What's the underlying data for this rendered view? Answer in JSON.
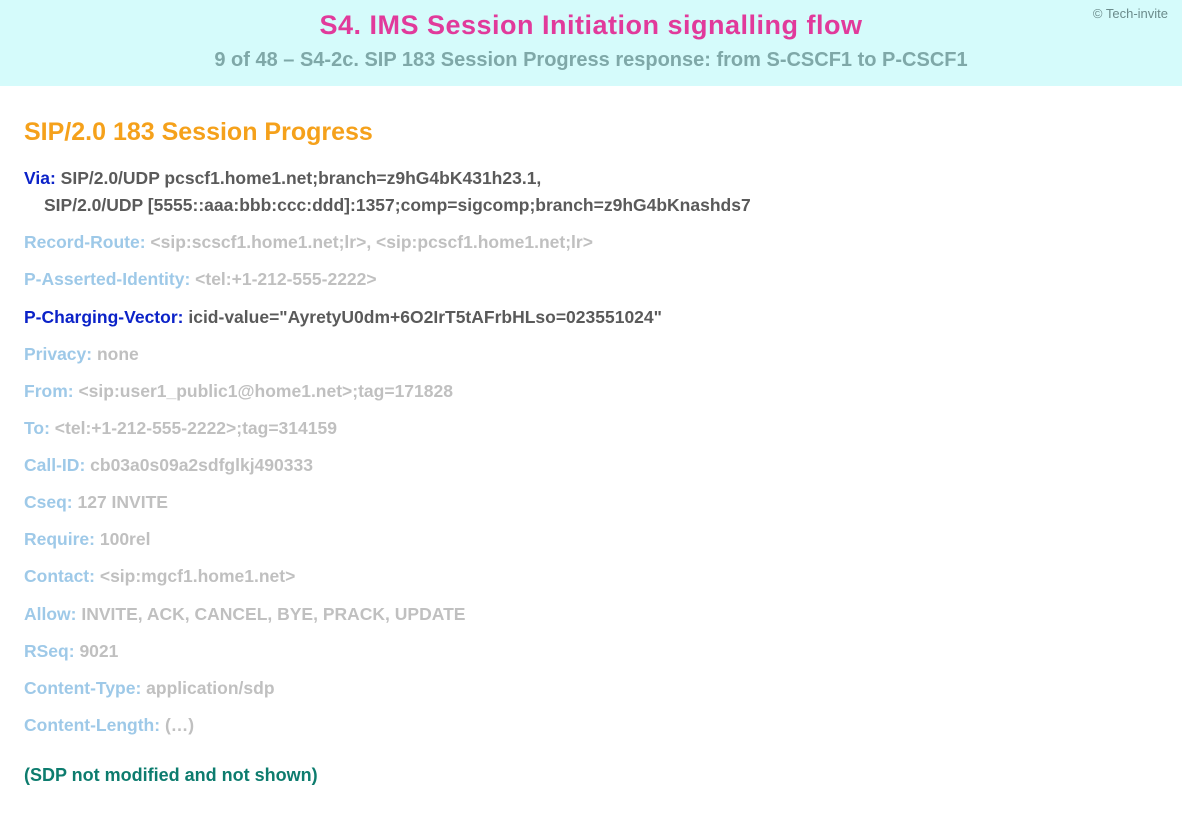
{
  "copyright": "© Tech-invite",
  "banner": {
    "title": "S4. IMS Session Initiation signalling flow",
    "subtitle": "9 of 48 – S4-2c. SIP 183 Session Progress response: from S-CSCF1 to P-CSCF1"
  },
  "sip": {
    "status_line": "SIP/2.0 183 Session Progress",
    "headers": [
      {
        "bold": true,
        "name": "Via",
        "value": "SIP/2.0/UDP pcscf1.home1.net;branch=z9hG4bK431h23.1,",
        "cont": "SIP/2.0/UDP [5555::aaa:bbb:ccc:ddd]:1357;comp=sigcomp;branch=z9hG4bKnashds7"
      },
      {
        "bold": false,
        "name": "Record-Route",
        "value": "<sip:scscf1.home1.net;lr>, <sip:pcscf1.home1.net;lr>"
      },
      {
        "bold": false,
        "name": "P-Asserted-Identity",
        "value": "<tel:+1-212-555-2222>"
      },
      {
        "bold": true,
        "name": "P-Charging-Vector",
        "value": "icid-value=\"AyretyU0dm+6O2IrT5tAFrbHLso=023551024\""
      },
      {
        "bold": false,
        "name": "Privacy",
        "value": "none"
      },
      {
        "bold": false,
        "name": "From",
        "value": "<sip:user1_public1@home1.net>;tag=171828"
      },
      {
        "bold": false,
        "name": "To",
        "value": "<tel:+1-212-555-2222>;tag=314159"
      },
      {
        "bold": false,
        "name": "Call-ID",
        "value": "cb03a0s09a2sdfglkj490333"
      },
      {
        "bold": false,
        "name": "Cseq",
        "value": "127 INVITE"
      },
      {
        "bold": false,
        "name": "Require",
        "value": "100rel"
      },
      {
        "bold": false,
        "name": "Contact",
        "value": "<sip:mgcf1.home1.net>"
      },
      {
        "bold": false,
        "name": "Allow",
        "value": "INVITE, ACK, CANCEL, BYE, PRACK, UPDATE"
      },
      {
        "bold": false,
        "name": "RSeq",
        "value": "9021"
      },
      {
        "bold": false,
        "name": "Content-Type",
        "value": "application/sdp"
      },
      {
        "bold": false,
        "name": "Content-Length",
        "value": "(…)"
      }
    ],
    "sdp_note": "(SDP not modified and not shown)"
  }
}
